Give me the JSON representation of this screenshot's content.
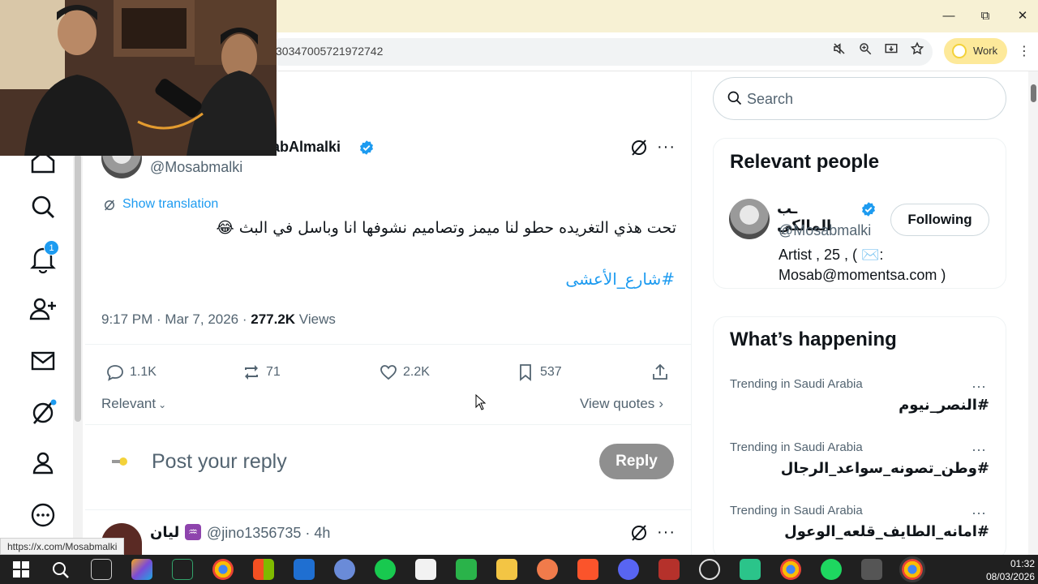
{
  "browser": {
    "url": "3034700572197274 2",
    "url_text": "30347005721972742",
    "profile_label": "Work"
  },
  "tweet": {
    "author_name_partial": "sabAlmalki",
    "author_handle": "@Mosabmalki",
    "show_translation": "Show translation",
    "text": "تحت هذي التغريده حطو لنا ميمز وتصاميم نشوفها انا وباسل في البث 😂",
    "hashtag": "#شارع_الأعشى",
    "time": "9:17 PM · Mar 7, 2026 · ",
    "views_count": "277.2K",
    "views_label": " Views",
    "replies": "1.1K",
    "retweets": "71",
    "likes": "2.2K",
    "bookmarks": "537",
    "sort_label": "Relevant",
    "view_quotes": "View quotes",
    "reply_placeholder": "Post your reply",
    "reply_button": "Reply"
  },
  "reply_item": {
    "name": "ليان",
    "handle": "@jino1356735",
    "time_sep": "·",
    "time": "4h"
  },
  "notifications": {
    "count": "1"
  },
  "search": {
    "placeholder": "Search"
  },
  "relevant_people": {
    "title": "Relevant people",
    "name": "ـب المالكي",
    "handle": "@Mosabmalki",
    "follow_label": "Following",
    "bio_line1": "Artist , 25 , ( ✉️:",
    "bio_line2": "Mosab@momentsa.com )"
  },
  "whats_happening": {
    "title": "What’s happening",
    "trends": [
      {
        "context": "Trending in Saudi Arabia",
        "name": "#النصر_نيوم"
      },
      {
        "context": "Trending in Saudi Arabia",
        "name": "#وطن_تصونه_سواعد_الرجال"
      },
      {
        "context": "Trending in Saudi Arabia",
        "name": "#امانه_الطايف_قلعه_الوعول"
      }
    ]
  },
  "status_tip": "https://x.com/Mosabmalki",
  "taskbar": {
    "time": "01:32",
    "date": "08/03/2026"
  },
  "colors": {
    "accent": "#1d9bf0",
    "titlebar": "#f7f1d4",
    "verified": "#1d9bf0"
  }
}
